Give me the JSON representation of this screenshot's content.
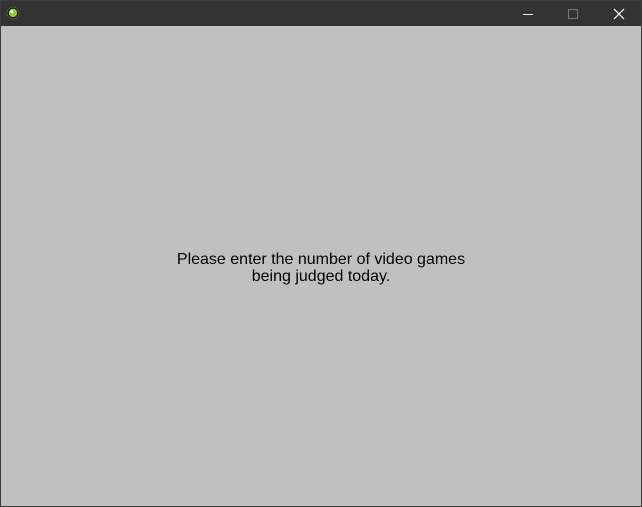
{
  "window": {
    "title": "",
    "icon": "green-orb-icon",
    "controls": {
      "minimize": "minimize-icon",
      "maximize": "maximize-icon",
      "close": "close-icon"
    },
    "colors": {
      "titlebar": "#333333",
      "client_background": "#c0c0c0",
      "text": "#000000"
    }
  },
  "content": {
    "message_line1": "Please enter the number of video games",
    "message_line2": "being judged today."
  }
}
